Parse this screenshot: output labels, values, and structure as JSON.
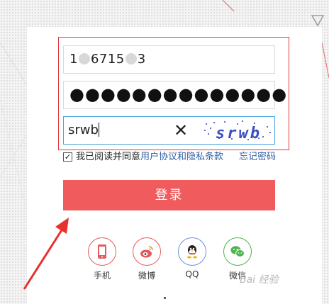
{
  "login_form": {
    "phone_prefix": "1",
    "phone_middle": "6715",
    "phone_suffix": "3",
    "password_masked": "●●●●●●●●●●●●●●",
    "captcha_value": "srwb",
    "captcha_image_text": "srwb",
    "clear_glyph": "✕",
    "agree_checked": "✓",
    "agree_prefix": "我已阅读并同意",
    "agree_link": "用户协议和隐私条款",
    "forgot_link": "忘记密码",
    "login_button": "登录"
  },
  "social_login": [
    {
      "label": "手机",
      "icon": "phone-icon"
    },
    {
      "label": "微博",
      "icon": "weibo-icon"
    },
    {
      "label": "QQ",
      "icon": "qq-icon"
    },
    {
      "label": "微信",
      "icon": "wechat-icon"
    }
  ],
  "watermark": "Bai 经验",
  "colors": {
    "accent_red": "#f05b5d",
    "highlight_border": "#e0393b",
    "link_blue": "#2f5fa8",
    "captcha_border": "#4aa3df"
  }
}
